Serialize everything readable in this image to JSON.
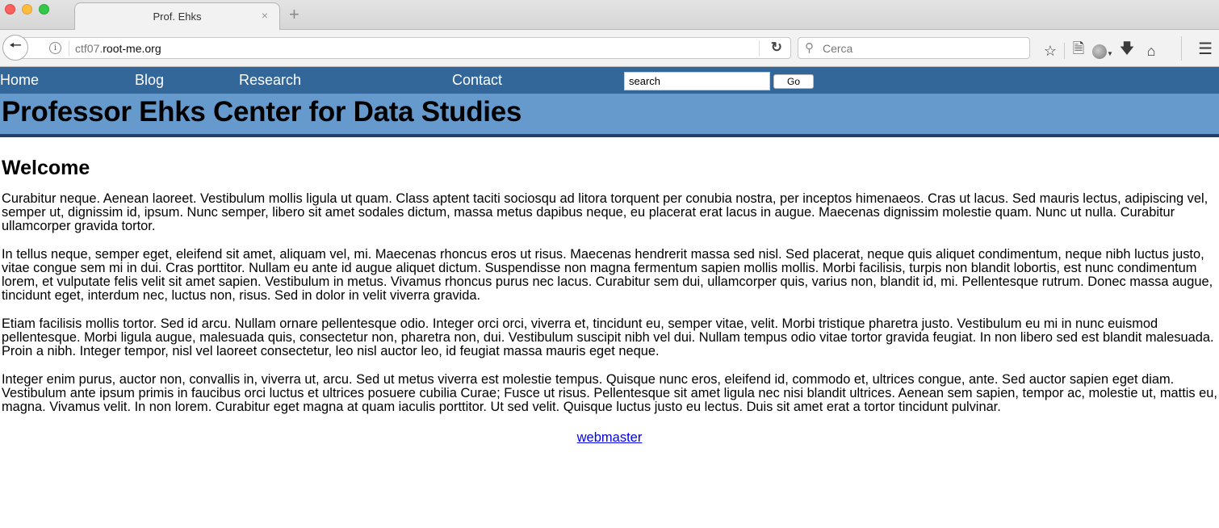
{
  "browser": {
    "tab_title": "Prof. Ehks",
    "tab_close_icon": "×",
    "new_tab_icon": "+",
    "url_dim": "ctf07.",
    "url_main": "root-me.org",
    "search_placeholder": "Cerca",
    "icons": [
      "back-arrow-icon",
      "info-icon",
      "reload-icon",
      "search-icon",
      "bookmark-star-icon",
      "reading-list-icon",
      "globe-icon",
      "download-icon",
      "home-icon",
      "hamburger-menu-icon"
    ]
  },
  "nav": {
    "items": [
      {
        "label": "Home"
      },
      {
        "label": "Blog"
      },
      {
        "label": "Research"
      },
      {
        "label": "Contact"
      }
    ],
    "search_value": "search",
    "go_label": "Go"
  },
  "header": {
    "title": "Professor Ehks Center for Data Studies"
  },
  "main": {
    "heading": "Welcome",
    "paragraphs": [
      "Curabitur neque. Aenean laoreet. Vestibulum mollis ligula ut quam. Class aptent taciti sociosqu ad litora torquent per conubia nostra, per inceptos himenaeos. Cras ut lacus. Sed mauris lectus, adipiscing vel, semper ut, dignissim id, ipsum. Nunc semper, libero sit amet sodales dictum, massa metus dapibus neque, eu placerat erat lacus in augue. Maecenas dignissim molestie quam. Nunc ut nulla. Curabitur ullamcorper gravida tortor.",
      "In tellus neque, semper eget, eleifend sit amet, aliquam vel, mi. Maecenas rhoncus eros ut risus. Maecenas hendrerit massa sed nisl. Sed placerat, neque quis aliquet condimentum, neque nibh luctus justo, vitae congue sem mi in dui. Cras porttitor. Nullam eu ante id augue aliquet dictum. Suspendisse non magna fermentum sapien mollis mollis. Morbi facilisis, turpis non blandit lobortis, est nunc condimentum lorem, et vulputate felis velit sit amet sapien. Vestibulum in metus. Vivamus rhoncus purus nec lacus. Curabitur sem dui, ullamcorper quis, varius non, blandit id, mi. Pellentesque rutrum. Donec massa augue, tincidunt eget, interdum nec, luctus non, risus. Sed in dolor in velit viverra gravida.",
      "Etiam facilisis mollis tortor. Sed id arcu. Nullam ornare pellentesque odio. Integer orci orci, viverra et, tincidunt eu, semper vitae, velit. Morbi tristique pharetra justo. Vestibulum eu mi in nunc euismod pellentesque. Morbi ligula augue, malesuada quis, consectetur non, pharetra non, dui. Vestibulum suscipit nibh vel dui. Nullam tempus odio vitae tortor gravida feugiat. In non libero sed est blandit malesuada. Proin a nibh. Integer tempor, nisl vel laoreet consectetur, leo nisl auctor leo, id feugiat massa mauris eget neque.",
      "Integer enim purus, auctor non, convallis in, viverra ut, arcu. Sed ut metus viverra est molestie tempus. Quisque nunc eros, eleifend id, commodo et, ultrices congue, ante. Sed auctor sapien eget diam. Vestibulum ante ipsum primis in faucibus orci luctus et ultrices posuere cubilia Curae; Fusce ut risus. Pellentesque sit amet ligula nec nisi blandit ultrices. Aenean sem sapien, tempor ac, molestie ut, mattis eu, magna. Vivamus velit. In non lorem. Curabitur eget magna at quam iaculis porttitor. Ut sed velit. Quisque luctus justo eu lectus. Duis sit amet erat a tortor tincidunt pulvinar."
    ]
  },
  "footer": {
    "link_label": "webmaster"
  },
  "colors": {
    "nav_bg": "#336699",
    "header_bg": "#6699cc",
    "header_border": "#1f3f6e",
    "link": "#0000ee"
  }
}
